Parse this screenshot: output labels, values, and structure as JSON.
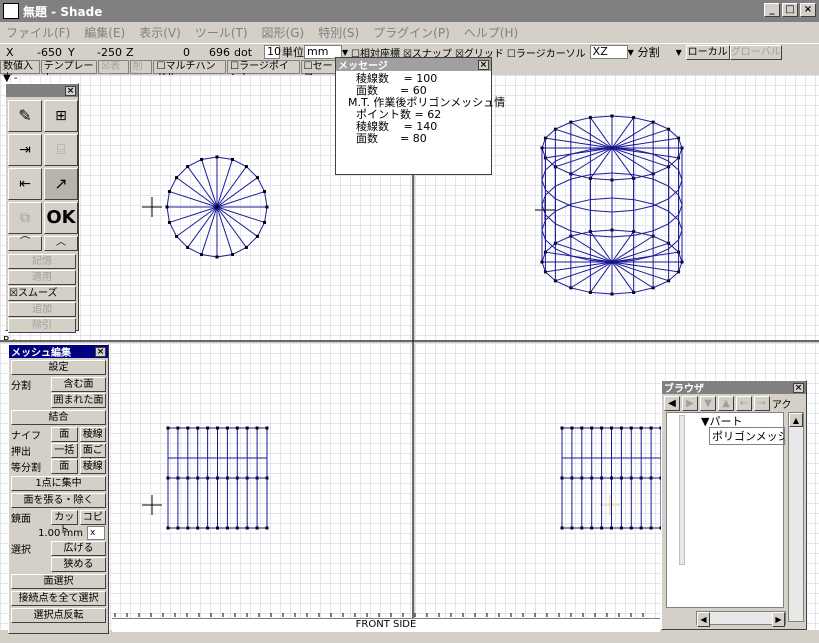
{
  "window": {
    "title": "無題 - Shade",
    "min": "_",
    "max": "□",
    "close": "×"
  },
  "menu": [
    "ファイル(F)",
    "編集(E)",
    "表示(V)",
    "ツール(T)",
    "図形(G)",
    "特別(S)",
    "プラグイン(P)",
    "ヘルプ(H)"
  ],
  "coords": {
    "x_label": "X",
    "x_val": "-650",
    "y_label": "Y",
    "y_val": "-250",
    "z_label": "Z",
    "z_val": "0",
    "dot_val": "696",
    "dot_unit": "dot",
    "scale": "10",
    "unit_label": "単位",
    "unit_val": "mm",
    "relative": "☐相対座標",
    "snap": "☒スナップ",
    "grid": "☒グリッド",
    "large_cursor": "☐ラージカーソル",
    "axis": "XZ",
    "split": "分割",
    "local": "ローカル",
    "global": "グローバル"
  },
  "tplbar": [
    "数値入力",
    "テンプレート",
    "☒表示",
    "削除",
    "☐マルチハンドル",
    "☐ラージポイント",
    "☐セーフ"
  ],
  "message": {
    "title": "メッセージ",
    "lines": [
      "稜線数　 = 100",
      "面数　　= 60",
      "M.T. 作業後ポリゴンメッシュ情",
      "ポイント数 = 62",
      "稜線数　 = 140",
      "面数　　= 80"
    ]
  },
  "toolpanel": {
    "ok": "OK",
    "memory": "記憶",
    "apply": "適用",
    "smooth": "☒スムーズ",
    "add": "追加",
    "subtract": "除引"
  },
  "mesh": {
    "title": "メッシュ編集",
    "settings": "設定",
    "split_label": "分割",
    "incl_face": "含む面",
    "enclosed_face": "囲まれた面",
    "combine": "結合",
    "knife_label": "ナイフ",
    "face": "面",
    "edge": "稜線",
    "extrude_label": "押出",
    "batch": "一括",
    "per_face": "面ごと",
    "equal_label": "等分割",
    "face2": "面",
    "edge2": "稜線",
    "converge": "1点に集中",
    "span": "面を張る・除く",
    "cut_label": "鏡面",
    "cut": "カット",
    "copy": "コピー",
    "dist": "1.00 mm",
    "dist_axis": "x",
    "select_label": "選択",
    "expand": "広げる",
    "shrink": "狭める",
    "face_select": "面選択",
    "select_all": "接続点を全て選択",
    "invert": "選択点反転"
  },
  "browser": {
    "title": "ブラウザ",
    "part": "▼パート",
    "item": "ポリゴンメッシュ",
    "extra": "アク"
  },
  "views": {
    "top_label": "▼ -",
    "front_label": "P -",
    "status": "FRONT SIDE"
  },
  "colors": {
    "wire": "#1a1a9a",
    "grid": "#e4e4ec"
  }
}
